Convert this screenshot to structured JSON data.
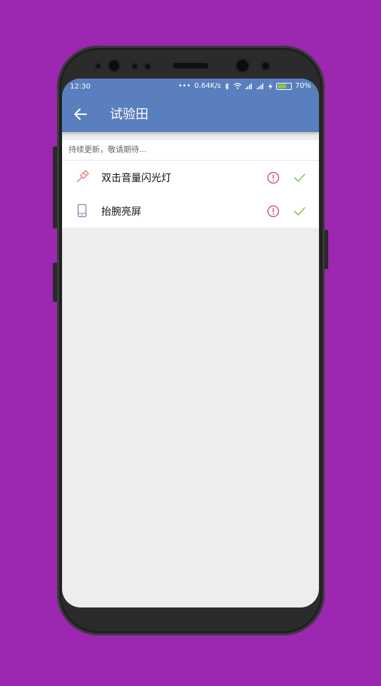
{
  "colors": {
    "background": "#9c27b0",
    "primary": "#5a7fbf",
    "warning": "#d0455a",
    "check": "#8bc34a",
    "icon_flashlight": "#e07a7a",
    "icon_phone": "#7a83b8",
    "battery": "#8bc34a"
  },
  "status_bar": {
    "time": "12:30",
    "network_speed": "0.64K/s",
    "battery_percent": "70%",
    "battery_level": 0.7,
    "icons": [
      "dots-icon",
      "bluetooth-icon",
      "wifi-icon",
      "signal-icon",
      "signal-icon",
      "charging-icon",
      "battery-icon"
    ]
  },
  "toolbar": {
    "back_icon": "arrow-left-icon",
    "title": "试验田"
  },
  "list": {
    "header": "持续更新，敬请期待...",
    "items": [
      {
        "label": "双击音量闪光灯",
        "icon": "flashlight-icon",
        "status_icon": "exclamation-circle-icon",
        "check_icon": "check-icon"
      },
      {
        "label": "抬腕亮屏",
        "icon": "phone-icon",
        "status_icon": "exclamation-circle-icon",
        "check_icon": "check-icon"
      }
    ]
  }
}
